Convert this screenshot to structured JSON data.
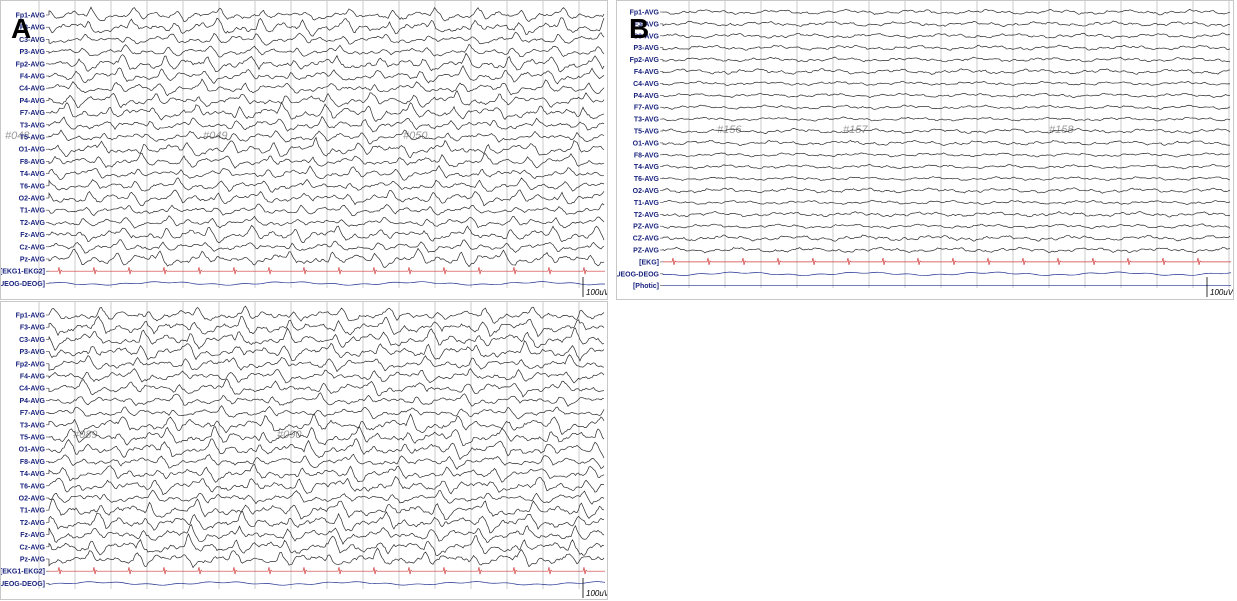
{
  "panels": [
    {
      "id": "A-top",
      "letter": "A",
      "channels": [
        "Fp1-AVG",
        "F3-AVG",
        "C3-AVG",
        "P3-AVG",
        "Fp2-AVG",
        "F4-AVG",
        "C4-AVG",
        "P4-AVG",
        "F7-AVG",
        "T3-AVG",
        "T5-AVG",
        "O1-AVG",
        "F8-AVG",
        "T4-AVG",
        "T6-AVG",
        "O2-AVG",
        "T1-AVG",
        "T2-AVG",
        "Fz-AVG",
        "Cz-AVG",
        "Pz-AVG",
        "[EKG1-EKG2]",
        "[UEOG-DEOG]"
      ],
      "stamps": [
        "#048",
        "#049",
        "#050"
      ],
      "scale": "100uV",
      "amp": 7.5,
      "spiky": true
    },
    {
      "id": "A-bottom",
      "letter": "",
      "channels": [
        "Fp1-AVG",
        "F3-AVG",
        "C3-AVG",
        "P3-AVG",
        "Fp2-AVG",
        "F4-AVG",
        "C4-AVG",
        "P4-AVG",
        "F7-AVG",
        "T3-AVG",
        "T5-AVG",
        "O1-AVG",
        "F8-AVG",
        "T4-AVG",
        "T6-AVG",
        "O2-AVG",
        "T1-AVG",
        "T2-AVG",
        "Fz-AVG",
        "Cz-AVG",
        "Pz-AVG",
        "[EKG1-EKG2]",
        "[UEOG-DEOG]"
      ],
      "stamps": [
        "#089",
        "#090"
      ],
      "scale": "100uV",
      "amp": 8,
      "spiky": true
    },
    {
      "id": "B",
      "letter": "B",
      "channels": [
        "Fp1-AVG",
        "F3-AVG",
        "C3-AVG",
        "P3-AVG",
        "Fp2-AVG",
        "F4-AVG",
        "C4-AVG",
        "P4-AVG",
        "F7-AVG",
        "T3-AVG",
        "T5-AVG",
        "O1-AVG",
        "F8-AVG",
        "T4-AVG",
        "T6-AVG",
        "O2-AVG",
        "T1-AVG",
        "T2-AVG",
        "PZ-AVG",
        "CZ-AVG",
        "PZ-AVG",
        "[EKG]",
        "UEOG-DEOG",
        "[Photic]"
      ],
      "stamps": [
        "#156",
        "#157",
        "#158"
      ],
      "scale": "100uV",
      "amp": 4.5,
      "spiky": false
    }
  ],
  "colors": {
    "trace": "#2b2b2b",
    "ekg": "#d03a3a",
    "eog": "#1f2f8f",
    "grid": "#b5b5b5",
    "label": "#1a237e"
  }
}
